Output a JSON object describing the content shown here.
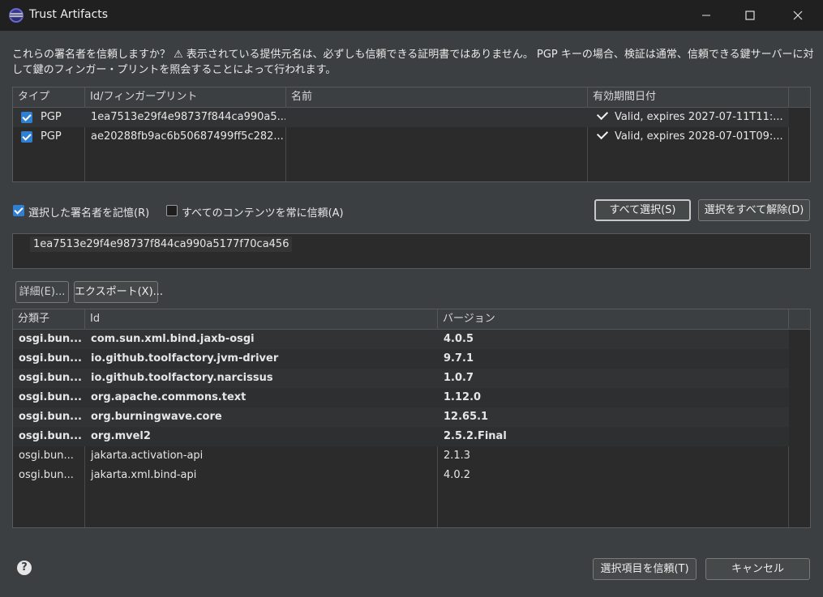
{
  "window": {
    "title": "Trust Artifacts"
  },
  "description": "これらの署名者を信頼しますか？ ⚠ 表示されている提供元名は、必ずしも信頼できる証明書ではありません。 PGP キーの場合、検証は通常、信頼できる鍵サーバーに対して鍵のフィンガー・プリントを照会することによって行われます。",
  "signers": {
    "columns": [
      "タイプ",
      "Id/フィンガープリント",
      "名前",
      "有効期間日付"
    ],
    "rows": [
      {
        "checked": true,
        "type": "PGP",
        "id": "1ea7513e29f4e98737f844ca990a5...",
        "name": "",
        "validity": "Valid, expires 2027-07-11T11:..."
      },
      {
        "checked": true,
        "type": "PGP",
        "id": "ae20288fb9ac6b50687499ff5c282...",
        "name": "",
        "validity": "Valid, expires 2028-07-01T09:..."
      }
    ]
  },
  "options": {
    "remember_label": "選択した署名者を記憶(R)",
    "remember_checked": true,
    "trust_all_label": "すべてのコンテンツを常に信頼(A)",
    "trust_all_checked": false,
    "select_all": "すべて選択(S)",
    "deselect_all": "選択をすべて解除(D)"
  },
  "fingerprint_detail": {
    "value": "1ea7513e29f4e98737f844ca990a5177f70ca456"
  },
  "actions": {
    "details": "詳細(E)...",
    "export": "エクスポート(X)..."
  },
  "artifacts": {
    "columns": [
      "分類子",
      "Id",
      "バージョン"
    ],
    "rows": [
      {
        "classifier": "osgi.bun...",
        "id": "com.sun.xml.bind.jaxb-osgi",
        "version": "4.0.5",
        "bold": true
      },
      {
        "classifier": "osgi.bun...",
        "id": "io.github.toolfactory.jvm-driver",
        "version": "9.7.1",
        "bold": true
      },
      {
        "classifier": "osgi.bun...",
        "id": "io.github.toolfactory.narcissus",
        "version": "1.0.7",
        "bold": true
      },
      {
        "classifier": "osgi.bun...",
        "id": "org.apache.commons.text",
        "version": "1.12.0",
        "bold": true
      },
      {
        "classifier": "osgi.bun...",
        "id": "org.burningwave.core",
        "version": "12.65.1",
        "bold": true
      },
      {
        "classifier": "osgi.bun...",
        "id": "org.mvel2",
        "version": "2.5.2.Final",
        "bold": true
      },
      {
        "classifier": "osgi.bun...",
        "id": "jakarta.activation-api",
        "version": "2.1.3",
        "bold": false
      },
      {
        "classifier": "osgi.bun...",
        "id": "jakarta.xml.bind-api",
        "version": "4.0.2",
        "bold": false
      }
    ]
  },
  "footer": {
    "help_glyph": "?",
    "trust_selected": "選択項目を信頼(T)",
    "cancel": "キャンセル"
  },
  "colors": {
    "accent": "#2f7fd2",
    "background": "#3c3f41",
    "table_bg": "#2b2b2b",
    "row_highlight": "#313335"
  }
}
